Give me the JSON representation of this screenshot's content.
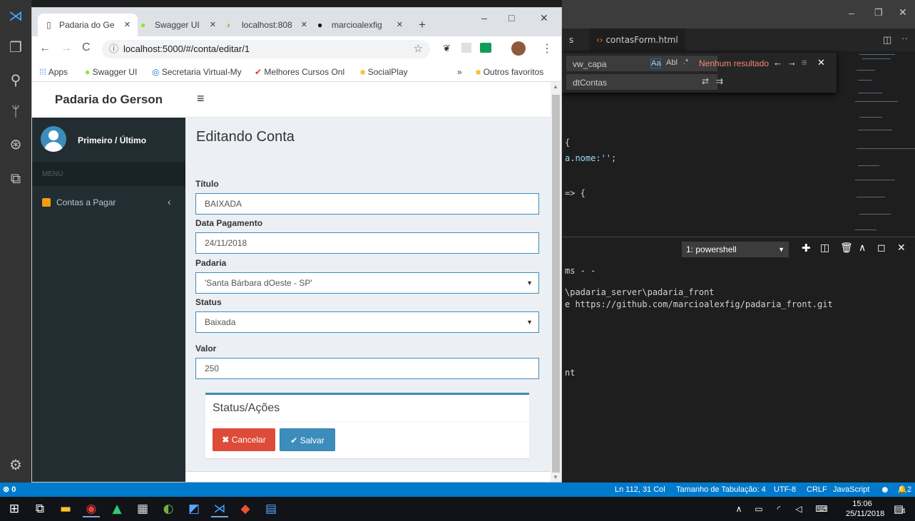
{
  "chrome": {
    "tabs": [
      {
        "label": "Padaria do Ge",
        "active": true
      },
      {
        "label": "Swagger UI",
        "active": false
      },
      {
        "label": "localhost:808",
        "active": false
      },
      {
        "label": "marcioalexfig",
        "active": false
      }
    ],
    "new_tab": "+",
    "window_controls": [
      "–",
      "□",
      "✕"
    ],
    "url": "localhost:5000/#/conta/editar/1",
    "bookmarks": [
      "Apps",
      "Swagger UI",
      "Secretaria Virtual-My",
      "Melhores Cursos Onl",
      "SocialPlay"
    ],
    "bookmarks_more": "»",
    "bookmarks_other": "Outros favoritos"
  },
  "app": {
    "brand": "Padaria do Gerson",
    "hamburger": "≡",
    "user_name": "Primeiro / Último",
    "menu_header": "MENU",
    "menu_item": "Contas a Pagar",
    "menu_chevron": "‹",
    "page_title": "Editando Conta",
    "form": {
      "titulo_label": "Título",
      "titulo_value": "BAIXADA",
      "data_label": "Data Pagamento",
      "data_value": "24/11/2018",
      "padaria_label": "Padaria",
      "padaria_value": "'Santa Bárbara dOeste - SP'",
      "status_label": "Status",
      "status_value": "Baixada",
      "valor_label": "Valor",
      "valor_value": "250"
    },
    "box_title": "Status/Ações",
    "cancel_label": "Cancelar",
    "save_label": "Salvar",
    "colors": {
      "accent": "#3c8dbc",
      "danger": "#dd4b39",
      "sidebar": "#222d32"
    }
  },
  "vscode": {
    "tab_left": "s",
    "tab_file": "contasForm.html",
    "find_value": "vw_capa",
    "find_result": "Nenhum resultado",
    "replace_value": "dtContas",
    "find_opts": [
      "Aa",
      "Abl",
      ".*"
    ],
    "code_lines": [
      "{",
      "a.nome:'';",
      "=> {"
    ],
    "terminal_select": "1: powershell",
    "terminal_lines": [
      "ms - -",
      "\\padaria_server\\padaria_front",
      "e https://github.com/marcioalexfig/padaria_front.git",
      "nt"
    ],
    "status_left": "⊗ 0",
    "status_items": [
      "Ln 112, 31 Col",
      "Tamanho de Tabulação: 4",
      "UTF-8",
      "CRLF",
      "JavaScript",
      "☻",
      "2"
    ]
  },
  "taskbar": {
    "time": "15:06",
    "date": "25/11/2018",
    "notif": "4"
  }
}
